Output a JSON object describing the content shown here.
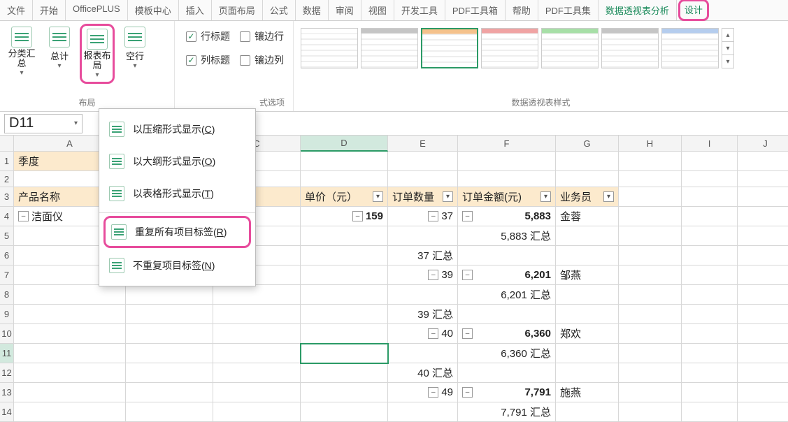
{
  "tabs": {
    "file": "文件",
    "home": "开始",
    "officeplus": "OfficePLUS",
    "template": "模板中心",
    "insert": "插入",
    "layout": "页面布局",
    "formula": "公式",
    "data": "数据",
    "review": "审阅",
    "view": "视图",
    "dev": "开发工具",
    "pdfbox": "PDF工具箱",
    "help": "帮助",
    "pdfset": "PDF工具集",
    "pivot_analyze": "数据透视表分析",
    "design": "设计"
  },
  "ribbon": {
    "subtotals": "分类汇总",
    "grandtotals": "总计",
    "report_layout": "报表布局",
    "blank_rows": "空行",
    "row_headers": "行标题",
    "col_headers": "列标题",
    "banded_rows": "镶边行",
    "banded_cols": "镶边列",
    "group_layout": "布局",
    "group_options_suffix": "式选项",
    "group_styles": "数据透视表样式"
  },
  "dropdown": {
    "compact": "以压缩形式显示(",
    "compact_k": "C",
    "outline": "以大纲形式显示(",
    "outline_k": "O",
    "tabular": "以表格形式显示(",
    "tabular_k": "T",
    "repeat": "重复所有项目标签(",
    "repeat_k": "R",
    "norepeat": "不重复项目标签(",
    "norepeat_k": "N",
    "close": ")"
  },
  "namebox": "D11",
  "columns": {
    "A": "A",
    "B": "B",
    "C": "C",
    "D": "D",
    "E": "E",
    "F": "F",
    "G": "G",
    "H": "H",
    "I": "I",
    "J": "J"
  },
  "pivot": {
    "r1_quarter": "季度",
    "r3_product": "产品名称",
    "r3_unitprice": "单价（元）",
    "r3_orderqty": "订单数量",
    "r3_orderamt": "订单金额(元)",
    "r3_sales": "业务员",
    "r4_product": "洁面仪",
    "r4_price": "159",
    "r4_qty": "37",
    "r4_amt": "5,883",
    "r4_name": "金蓉",
    "r5_sub": "5,883 汇总",
    "r6_sum": "37 汇总",
    "r7_qty": "39",
    "r7_amt": "6,201",
    "r7_name": "邹燕",
    "r8_sub": "6,201 汇总",
    "r9_sum": "39 汇总",
    "r10_qty": "40",
    "r10_amt": "6,360",
    "r10_name": "郑欢",
    "r11_sub": "6,360 汇总",
    "r12_sum": "40 汇总",
    "r13_qty": "49",
    "r13_amt": "7,791",
    "r13_name": "施燕",
    "r14_sub": "7,791 汇总"
  }
}
